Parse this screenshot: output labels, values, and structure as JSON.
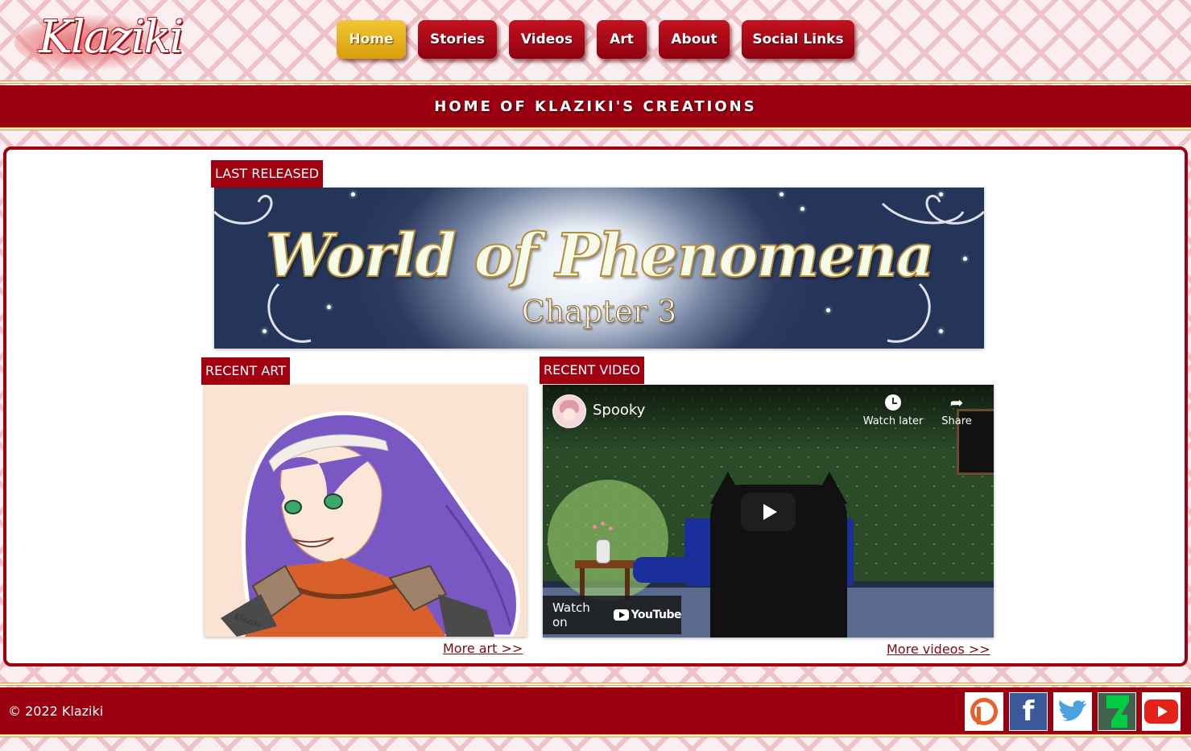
{
  "logo": {
    "text": "Klaziki"
  },
  "nav": {
    "items": [
      {
        "label": "Home",
        "active": true
      },
      {
        "label": "Stories"
      },
      {
        "label": "Videos"
      },
      {
        "label": "Art"
      },
      {
        "label": "About"
      },
      {
        "label": "Social Links"
      }
    ]
  },
  "banner": {
    "title": "HOME OF KLAZIKI'S CREATIONS"
  },
  "last_released": {
    "tag": "LAST RELEASED",
    "title": "World of Phenomena",
    "subtitle": "Chapter 3"
  },
  "recent_art": {
    "tag": "RECENT ART",
    "signature": "Klaziki",
    "more": "More art >>"
  },
  "recent_video": {
    "tag": "RECENT VIDEO",
    "video_title": "Spooky",
    "watch_later": "Watch later",
    "share": "Share",
    "watch_on": "Watch on",
    "youtube": "YouTube",
    "more": "More videos >>"
  },
  "footer": {
    "copyright": "© 2022 Klaziki",
    "social_icons": [
      "patreon-icon",
      "facebook-icon",
      "twitter-icon",
      "deviantart-icon",
      "youtube-icon"
    ]
  },
  "colors": {
    "accent": "#9a0010",
    "active_nav": "#e8b422"
  }
}
